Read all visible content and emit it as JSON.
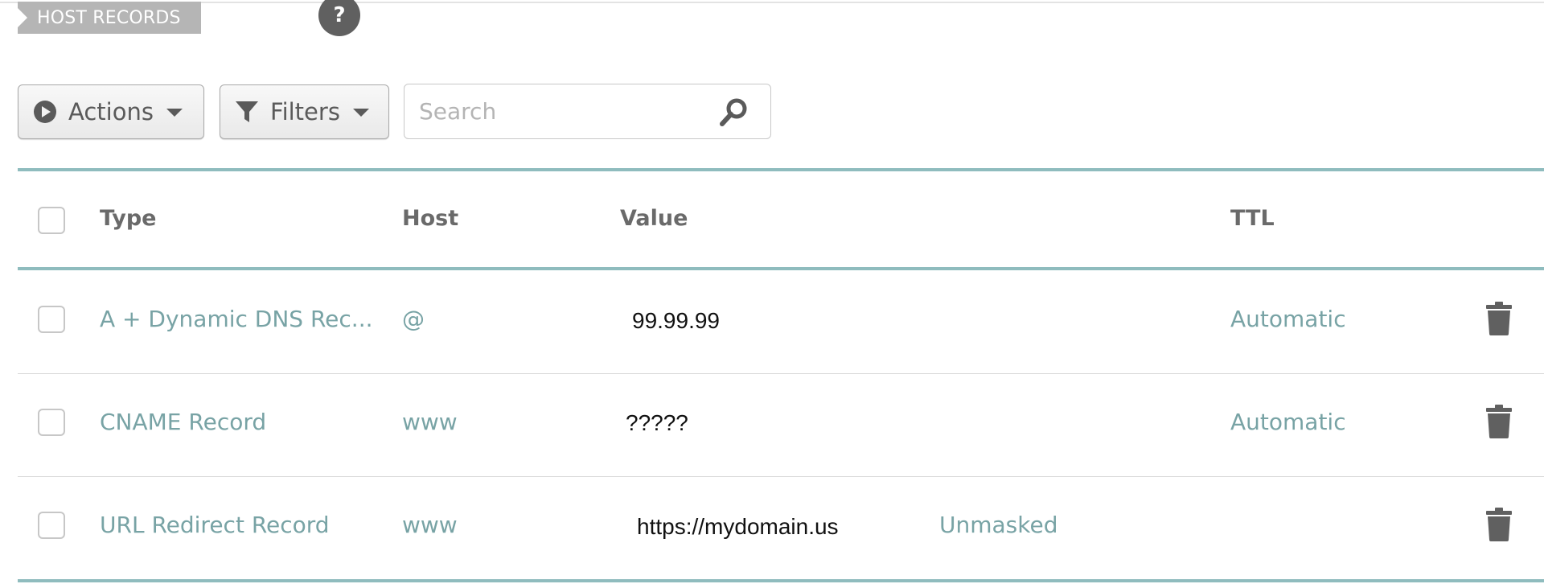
{
  "section": {
    "title": "HOST RECORDS",
    "help_label": "?"
  },
  "toolbar": {
    "actions_label": "Actions",
    "filters_label": "Filters",
    "search_placeholder": "Search"
  },
  "table": {
    "columns": {
      "type": "Type",
      "host": "Host",
      "value": "Value",
      "ttl": "TTL"
    },
    "rows": [
      {
        "type": "A + Dynamic DNS Rec...",
        "host": "@",
        "value": "99.99.99",
        "extra": "",
        "ttl": "Automatic"
      },
      {
        "type": "CNAME Record",
        "host": "www",
        "value": "?????",
        "extra": "",
        "ttl": "Automatic"
      },
      {
        "type": "URL Redirect Record",
        "host": "www",
        "value": "https://mydomain.us",
        "extra": "Unmasked",
        "ttl": ""
      }
    ]
  },
  "colors": {
    "accent_teal": "#78a3a5",
    "rule_teal": "#8fbcbe",
    "icon_gray": "#606060"
  },
  "icons": [
    "play-circle-icon",
    "caret-down-icon",
    "filter-funnel-icon",
    "search-magnifier-icon",
    "trash-icon"
  ]
}
